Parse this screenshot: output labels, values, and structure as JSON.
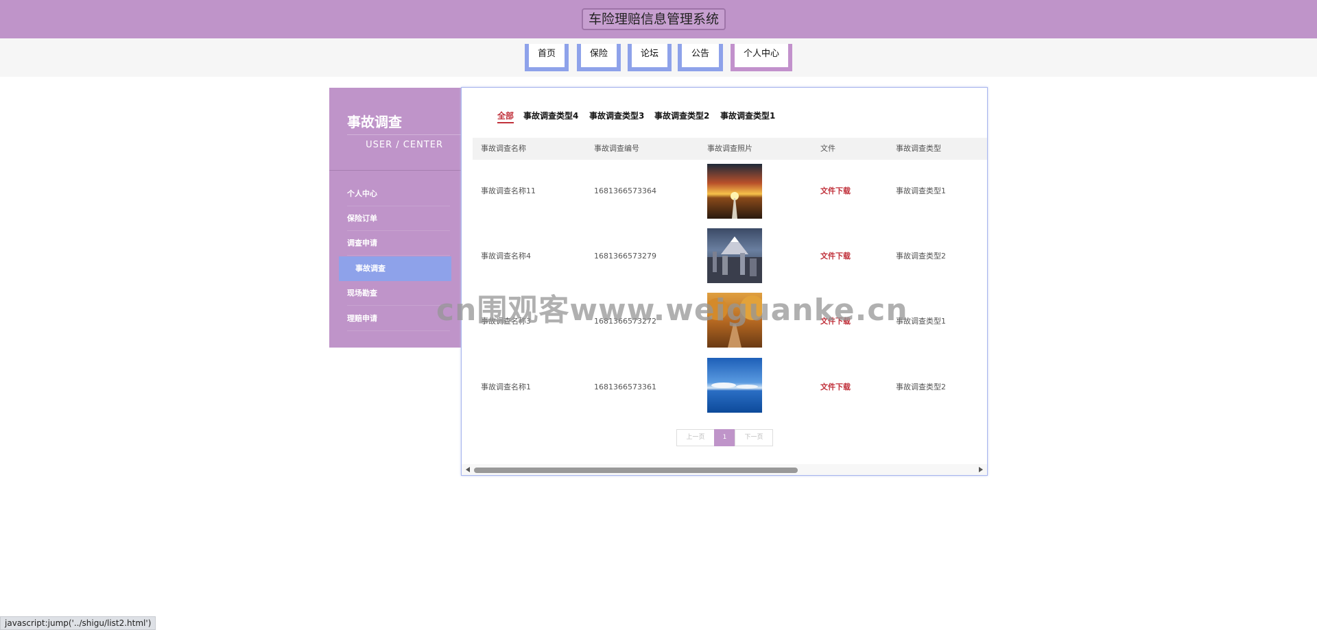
{
  "header": {
    "title": "车险理赔信息管理系统"
  },
  "nav": {
    "items": [
      {
        "label": "首页"
      },
      {
        "label": "保险"
      },
      {
        "label": "论坛"
      },
      {
        "label": "公告"
      },
      {
        "label": "个人中心"
      }
    ]
  },
  "sidebar": {
    "title": "事故调查",
    "subtitle": "USER / CENTER",
    "items": [
      {
        "label": "个人中心"
      },
      {
        "label": "保险订单"
      },
      {
        "label": "调查申请"
      },
      {
        "label": "事故调查"
      },
      {
        "label": "现场勘查"
      },
      {
        "label": "理赔申请"
      }
    ]
  },
  "filters": [
    "全部",
    "事故调查类型4",
    "事故调查类型3",
    "事故调查类型2",
    "事故调查类型1"
  ],
  "table": {
    "headers": [
      "事故调查名称",
      "事故调查编号",
      "事故调查照片",
      "文件",
      "事故调查类型"
    ],
    "rows": [
      {
        "name": "事故调查名称11",
        "code": "1681366573364",
        "photo": "sunset-road-photo",
        "file": "文件下载",
        "type": "事故调查类型1"
      },
      {
        "name": "事故调查名称4",
        "code": "1681366573279",
        "photo": "city-mountain-photo",
        "file": "文件下载",
        "type": "事故调查类型2"
      },
      {
        "name": "事故调查名称3",
        "code": "1681366573272",
        "photo": "autumn-path-photo",
        "file": "文件下载",
        "type": "事故调查类型1"
      },
      {
        "name": "事故调查名称1",
        "code": "1681366573361",
        "photo": "ocean-sky-photo",
        "file": "文件下载",
        "type": "事故调查类型2"
      }
    ]
  },
  "pagination": {
    "prev": "上一页",
    "current": "1",
    "next": "下一页"
  },
  "watermark": "cn围观客www.weiguanke.cn",
  "status_bar": "javascript:jump('../shigu/list2.html')",
  "colors": {
    "header": "#bf94c9",
    "accent": "#8ea2ea",
    "link_red": "#c0303a"
  }
}
